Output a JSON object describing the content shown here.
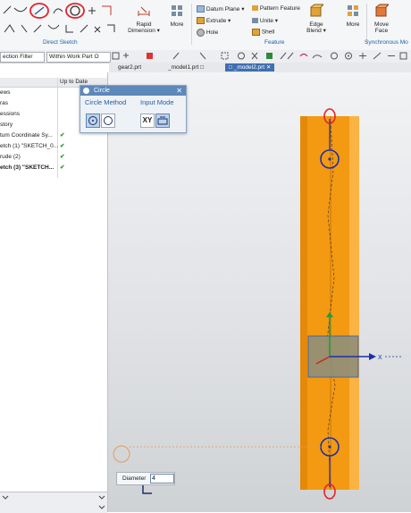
{
  "ribbon": {
    "groups": {
      "direct_sketch": "Direct Sketch",
      "feature": "Feature",
      "synchronous": "Synchronous Mo"
    },
    "rapid_dimension": {
      "line1": "Rapid",
      "line2": "Dimension ▾"
    },
    "more_sketch": "More",
    "more_feature": "More",
    "datum_plane": "Datum Plane ▾",
    "extrude": "Extrude ▾",
    "hole": "Hole",
    "pattern_feature": "Pattern Feature",
    "unite": "Unite ▾",
    "shell": "Shell",
    "edge_blend": {
      "line1": "Edge",
      "line2": "Blend ▾"
    },
    "move_face": {
      "line1": "Move",
      "line2": "Face"
    }
  },
  "filterbar": {
    "selection_filter": "ection Filter",
    "scope": "Within Work Part O"
  },
  "tabs": [
    {
      "label": "gear2.prt"
    },
    {
      "label": "_model1.prt"
    },
    {
      "label": "_model2.prt"
    }
  ],
  "navigator": {
    "status_header": "Up to Date",
    "rows": [
      {
        "name": "ews",
        "check": ""
      },
      {
        "name": "ras",
        "check": ""
      },
      {
        "name": "essions",
        "check": ""
      },
      {
        "name": "story",
        "check": ""
      },
      {
        "name": "tum Coordinate Sy...",
        "check": "✔"
      },
      {
        "name": "etch (1) \"SKETCH_0...",
        "check": "✔"
      },
      {
        "name": "rude (2)",
        "check": "✔"
      },
      {
        "name": "etch (3) \"SKETCH...",
        "check": "✔"
      }
    ]
  },
  "dialog": {
    "title": "Circle",
    "circle_method": "Circle Method",
    "input_mode": "Input Mode",
    "xy": "XY"
  },
  "diameter": {
    "label": "Diameter",
    "value": "4"
  },
  "colors": {
    "accent": "#3f6fb0",
    "cylinder": "#f39a12",
    "sketch": "#1e2fa8",
    "annotation_red": "#e0242b",
    "check": "#1a9a2b"
  }
}
